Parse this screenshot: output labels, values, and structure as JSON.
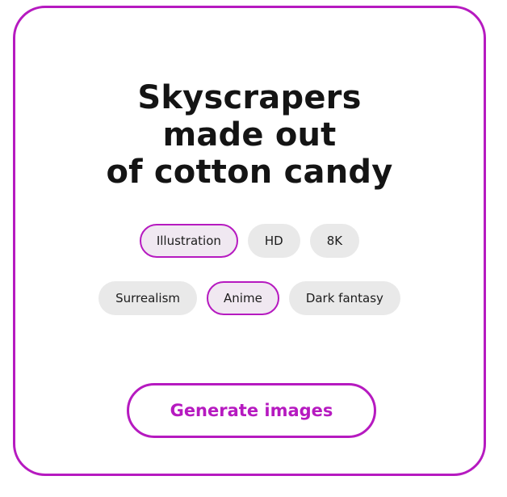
{
  "prompt": {
    "lines": [
      "Skyscrapers",
      "made out",
      "of cotton candy"
    ]
  },
  "style_tags": {
    "row1": [
      {
        "label": "Illustration",
        "selected": true
      },
      {
        "label": "HD",
        "selected": false
      },
      {
        "label": "8K",
        "selected": false
      }
    ],
    "row2": [
      {
        "label": "Surrealism",
        "selected": false
      },
      {
        "label": "Anime",
        "selected": true
      },
      {
        "label": "Dark fantasy",
        "selected": false
      }
    ]
  },
  "generate_button": {
    "label": "Generate images"
  },
  "colors": {
    "accent": "#b61ac0",
    "chip_background": "#e9e9e9",
    "selected_chip_background": "#f0e8f1",
    "text": "#141414"
  }
}
